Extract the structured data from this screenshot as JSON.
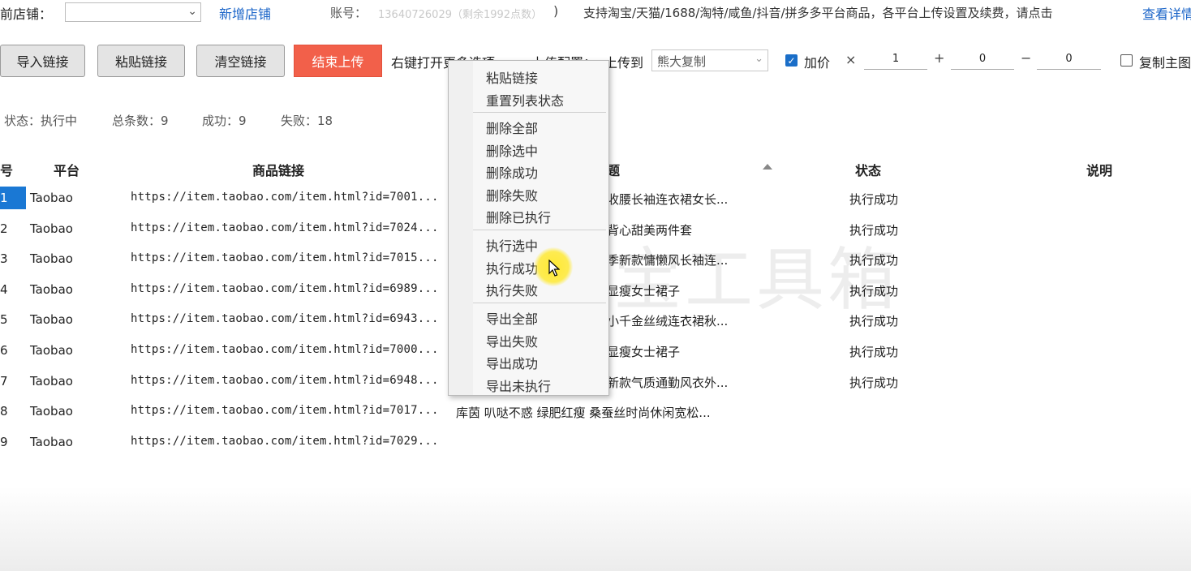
{
  "top": {
    "store_label": "前店铺：",
    "add_store": "新增店铺",
    "account_label": "账号：",
    "account_value": "13640726029（剩余1992点数）",
    "account_close": ")",
    "support_text": "支持淘宝/天猫/1688/淘特/咸鱼/抖音/拼多多平台商品，各平台上传设置及续费，请点击",
    "detail_link": "查看详情"
  },
  "toolbar": {
    "import_label": "导入链接",
    "paste_label": "粘贴链接",
    "clear_label": "清空链接",
    "stop_label": "结束上传",
    "right_click_hint": "右键打开更多选项",
    "upload_config": "上传配置：",
    "upload_to": "上传到",
    "target_value": "熊大复制",
    "markup_label": "加价",
    "markup_checked": true,
    "multiply_op": "×",
    "multiply_value": "1",
    "plus_op": "+",
    "plus_value": "0",
    "minus_op": "−",
    "minus_value": "0",
    "copy_main_label": "复制主图",
    "copy_main_checked": false
  },
  "stats": {
    "status": "状态：执行中",
    "total": "总条数：9",
    "success": "成功：9",
    "fail": "失败：18"
  },
  "table": {
    "headers": {
      "index": "号",
      "platform": "平台",
      "link": "商品链接",
      "title": "题",
      "status": "状态",
      "note": "说明"
    },
    "rows": [
      {
        "idx": "1",
        "platform": "Taobao",
        "url": "https://item.taobao.com/item.html?id=7001...",
        "title": "收腰长袖连衣裙女长...",
        "status": "执行成功"
      },
      {
        "idx": "2",
        "platform": "Taobao",
        "url": "https://item.taobao.com/item.html?id=7024...",
        "title": "背心甜美两件套",
        "status": "执行成功"
      },
      {
        "idx": "3",
        "platform": "Taobao",
        "url": "https://item.taobao.com/item.html?id=7015...",
        "title": "季新款慵懒风长袖连...",
        "status": "执行成功"
      },
      {
        "idx": "4",
        "platform": "Taobao",
        "url": "https://item.taobao.com/item.html?id=6989...",
        "title": "显瘦女士裙子",
        "status": "执行成功"
      },
      {
        "idx": "5",
        "platform": "Taobao",
        "url": "https://item.taobao.com/item.html?id=6943...",
        "title": "小千金丝绒连衣裙秋...",
        "status": "执行成功"
      },
      {
        "idx": "6",
        "platform": "Taobao",
        "url": "https://item.taobao.com/item.html?id=7000...",
        "title": "显瘦女士裙子",
        "status": "执行成功"
      },
      {
        "idx": "7",
        "platform": "Taobao",
        "url": "https://item.taobao.com/item.html?id=6948...",
        "title": "新款气质通勤风衣外...",
        "status": "执行成功"
      },
      {
        "idx": "8",
        "platform": "Taobao",
        "url": "https://item.taobao.com/item.html?id=7017...",
        "title": "库茵 叭哒不惑 绿肥红瘦 桑蚕丝时尚休闲宽松...",
        "status": ""
      },
      {
        "idx": "9",
        "platform": "Taobao",
        "url": "https://item.taobao.com/item.html?id=7029...",
        "title": "",
        "status": ""
      }
    ]
  },
  "context_menu": {
    "items": [
      "粘贴链接",
      "重置列表状态",
      "删除全部",
      "删除选中",
      "删除成功",
      "删除失败",
      "删除已执行",
      "执行选中",
      "执行成功",
      "执行失败",
      "导出全部",
      "导出失败",
      "导出成功",
      "导出未执行"
    ]
  },
  "watermark": "晓微宝工具箱",
  "colors": {
    "accent_blue": "#1a64c8",
    "stop_red": "#f2604a",
    "selected_row": "#1a78d4"
  }
}
